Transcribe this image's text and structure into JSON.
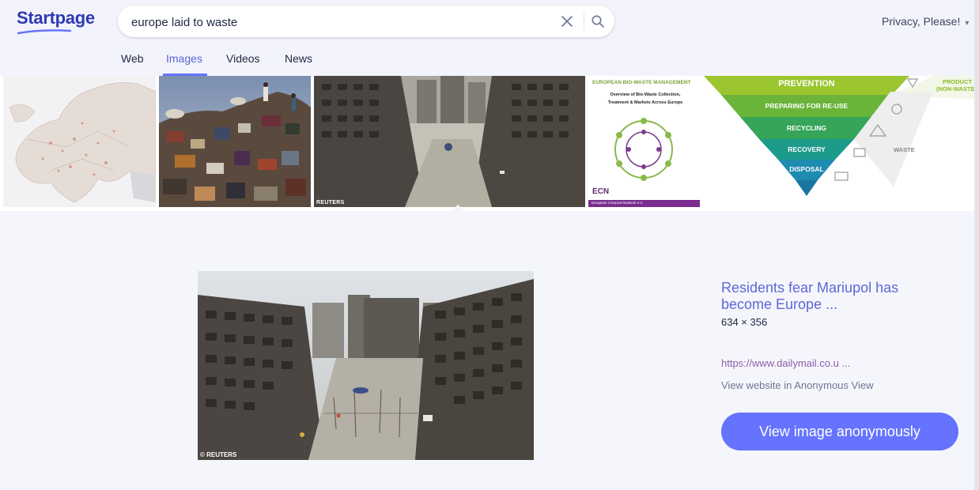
{
  "header": {
    "logo": "Startpage",
    "search": {
      "value": "europe laid to waste",
      "placeholder": ""
    },
    "privacy": "Privacy, Please!"
  },
  "tabs": [
    {
      "label": "Web",
      "active": false
    },
    {
      "label": "Images",
      "active": true
    },
    {
      "label": "Videos",
      "active": false
    },
    {
      "label": "News",
      "active": false
    }
  ],
  "thumbnails": [
    {
      "name": "europe-waste-map"
    },
    {
      "name": "textile-waste-dump"
    },
    {
      "name": "destroyed-apartments-mariupol",
      "watermark": "REUTERS"
    },
    {
      "name": "bio-waste-report",
      "heading": "EUROPEAN BIO-WASTE MANAGEMENT",
      "subtitle_lines": [
        "Overview of Bio-Waste Collection,",
        "Treatment & Markets Across Europe"
      ],
      "org": "ECN",
      "footer": "European Compost Network e.V."
    },
    {
      "name": "waste-hierarchy-pyramid",
      "levels": [
        "PREVENTION",
        "PREPARING FOR RE-USE",
        "RECYCLING",
        "RECOVERY",
        "DISPOSAL"
      ],
      "product_label_lines": [
        "PRODUCT",
        "(NON-WASTE)"
      ],
      "waste_label": "WASTE"
    }
  ],
  "preview": {
    "watermark": "© REUTERS",
    "title": "Residents fear Mariupol has become Europe ...",
    "dimensions": "634 × 356",
    "url": "https://www.dailymail.co.u ...",
    "anon_view": "View website in Anonymous View",
    "button": "View image anonymously"
  },
  "colors": {
    "accent": "#6573ff",
    "link": "#5f67d5",
    "url": "#8d5ea8",
    "background_header": "#f3f4fb",
    "background_preview": "#f5f6fb"
  },
  "icons": {
    "clear": "close-icon",
    "search": "search-icon",
    "privacy_dropdown": "chevron-down-icon"
  }
}
